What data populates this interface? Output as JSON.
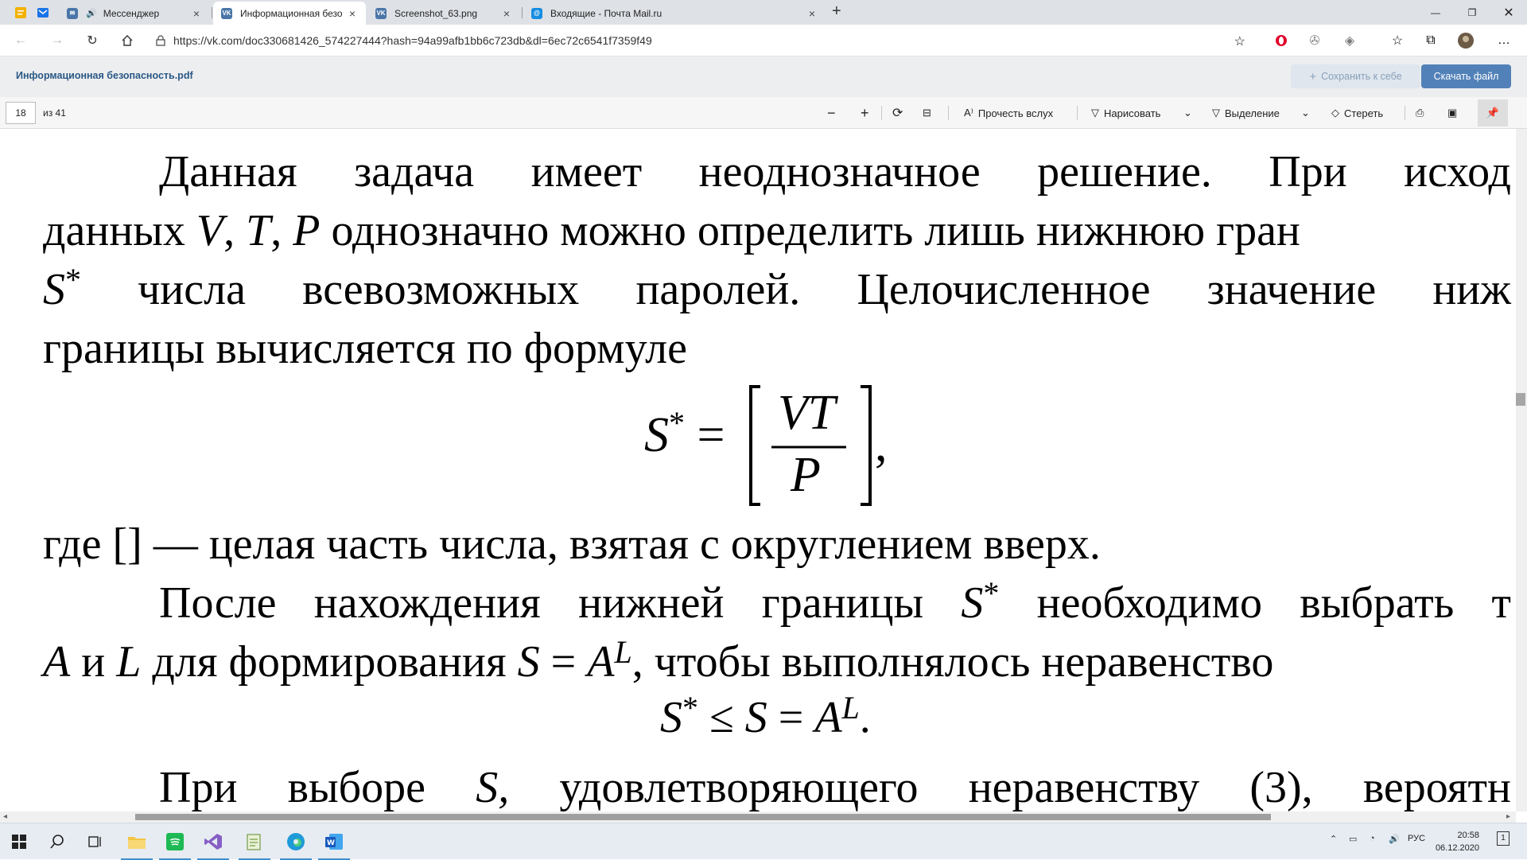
{
  "browser": {
    "tabs": [
      {
        "title": "Мессенджер",
        "favicon": "vk-messenger-icon",
        "icon_color": "#4a76a8"
      },
      {
        "title": "Информационная безопасность",
        "favicon": "vk-icon",
        "icon_color": "#4a76a8",
        "active": true
      },
      {
        "title": "Screenshot_63.png",
        "favicon": "vk-icon",
        "icon_color": "#4a76a8"
      },
      {
        "title": "Входящие - Почта Mail.ru",
        "favicon": "mail-ru-icon",
        "icon_color": "#168de2"
      }
    ],
    "url": "https://vk.com/doc330681426_574227444?hash=94a99afb1bb6c723db&dl=6ec72c6541f7359f49"
  },
  "doc": {
    "filename": "Информационная безопасность.pdf",
    "save_label": "Сохранить к себе",
    "download_label": "Скачать файл",
    "accent": "#5181b8"
  },
  "pdf_toolbar": {
    "page_number": "18",
    "page_count": "из 41",
    "read_aloud": "Прочесть вслух",
    "draw": "Нарисовать",
    "highlight": "Выделение",
    "erase": "Стереть"
  },
  "content": {
    "p1_l1": [
      "Данная",
      "задача",
      "имеет",
      "неоднозначное",
      "решение.",
      "При",
      "исход"
    ],
    "p1_l2_a": "данных ",
    "p1_l2_v": "V",
    "p1_l2_c1": ", ",
    "p1_l2_t": "T",
    "p1_l2_c2": ", ",
    "p1_l2_p": "P",
    "p1_l2_b": " однозначно можно определить лишь нижнюю гран",
    "p1_l3_s": "S",
    "p1_l3_star": "*",
    "p1_l3_words": [
      "числа",
      "всевозможных",
      "паролей.",
      "Целочисленное",
      "значение",
      "ниж"
    ],
    "p1_l4": "границы вычисляется по формуле",
    "f1_lhs": "S",
    "f1_star": "*",
    "f1_eq": " =",
    "f1_num": "VT",
    "f1_den": "P",
    "f1_comma": ",",
    "where": "где [] — целая часть числа, взятая с округлением вверх.",
    "p2_l1_words": [
      "После",
      "нахождения",
      "нижней",
      "границы"
    ],
    "p2_l1_s": "S",
    "p2_l1_star": "*",
    "p2_l1_tail": [
      "необходимо",
      "выбрать",
      "т"
    ],
    "p2_l2_a": "A",
    "p2_l2_and": " и ",
    "p2_l2_l": "L",
    "p2_l2_mid": " для формирования ",
    "p2_l2_s": "S",
    "p2_l2_eq": " = ",
    "p2_l2_A": "A",
    "p2_l2_L": "L",
    "p2_l2_tail": ", чтобы выполнялось неравенство",
    "f2_s": "S",
    "f2_star": "*",
    "f2_le": " ≤ ",
    "f2_s2": "S",
    "f2_eq": " = ",
    "f2_a": "A",
    "f2_l": "L",
    "f2_dot": ".",
    "p3_words": [
      "При",
      "выборе",
      "S,",
      "удовлетворяющего",
      "неравенству",
      "(3),",
      "вероятн"
    ]
  },
  "taskbar": {
    "lang": "РУС",
    "time": "20:58",
    "date": "06.12.2020",
    "notifications": "1"
  }
}
